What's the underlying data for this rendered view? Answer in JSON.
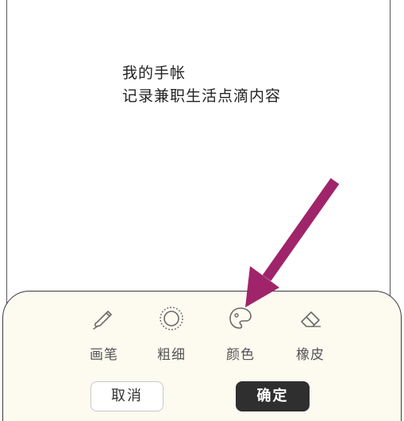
{
  "page": {
    "title": "我的手帐",
    "subtitle": "记录兼职生活点滴内容"
  },
  "toolbar": {
    "tools": [
      {
        "label": "画笔",
        "icon": "pencil-icon"
      },
      {
        "label": "粗细",
        "icon": "stroke-width-icon"
      },
      {
        "label": "颜色",
        "icon": "palette-icon"
      },
      {
        "label": "橡皮",
        "icon": "eraser-icon"
      }
    ],
    "cancel_label": "取消",
    "confirm_label": "确定"
  },
  "annotation": {
    "arrow_color": "#a0246a",
    "points_to": "颜色"
  }
}
